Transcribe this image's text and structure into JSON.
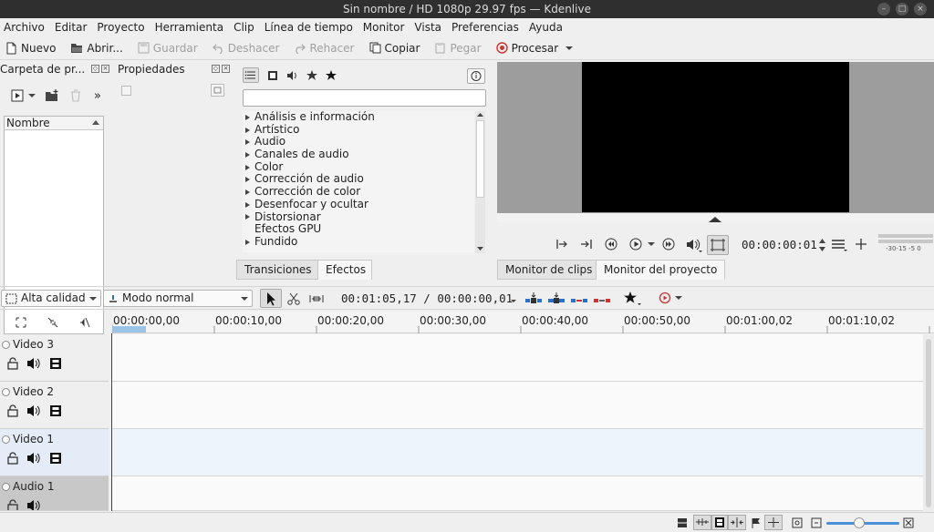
{
  "window": {
    "title": "Sin nombre / HD 1080p 29.97 fps — Kdenlive"
  },
  "menubar": [
    "Archivo",
    "Editar",
    "Proyecto",
    "Herramienta",
    "Clip",
    "Línea de tiempo",
    "Monitor",
    "Vista",
    "Preferencias",
    "Ayuda"
  ],
  "toolbar": {
    "new": "Nuevo",
    "open": "Abrir...",
    "save": "Guardar",
    "undo": "Deshacer",
    "redo": "Rehacer",
    "copy": "Copiar",
    "paste": "Pegar",
    "render": "Procesar"
  },
  "project_bin": {
    "title": "Carpeta de pr...",
    "column": "Nombre"
  },
  "properties": {
    "title": "Propiedades"
  },
  "effects": {
    "search_placeholder": "",
    "items": [
      {
        "label": "Análisis e información",
        "expandable": true
      },
      {
        "label": "Artístico",
        "expandable": true
      },
      {
        "label": "Audio",
        "expandable": true
      },
      {
        "label": "Canales de audio",
        "expandable": true
      },
      {
        "label": "Color",
        "expandable": true
      },
      {
        "label": "Corrección de audio",
        "expandable": true
      },
      {
        "label": "Corrección de color",
        "expandable": true
      },
      {
        "label": "Desenfocar y ocultar",
        "expandable": true
      },
      {
        "label": "Distorsionar",
        "expandable": true
      },
      {
        "label": "Efectos GPU",
        "expandable": false
      },
      {
        "label": "Fundido",
        "expandable": true
      }
    ],
    "tabs": [
      "Transiciones",
      "Efectos"
    ]
  },
  "monitor": {
    "timecode": "00:00:00:01",
    "vu_scale": "-30-15 -5 0",
    "tabs": [
      "Monitor de clips",
      "Monitor del proyecto"
    ]
  },
  "timeline_toolbar": {
    "quality": "Alta calidad",
    "mode": "Modo normal",
    "position": "00:01:05,17 / 00:00:00,01"
  },
  "ruler": [
    "00:00:00,00",
    "00:00:10,00",
    "00:00:20,00",
    "00:00:30,00",
    "00:00:40,00",
    "00:00:50,00",
    "00:01:00,02",
    "00:01:10,02"
  ],
  "tracks": [
    {
      "name": "Video 3",
      "type": "video"
    },
    {
      "name": "Video 2",
      "type": "video"
    },
    {
      "name": "Video 1",
      "type": "video"
    },
    {
      "name": "Audio 1",
      "type": "audio"
    }
  ]
}
